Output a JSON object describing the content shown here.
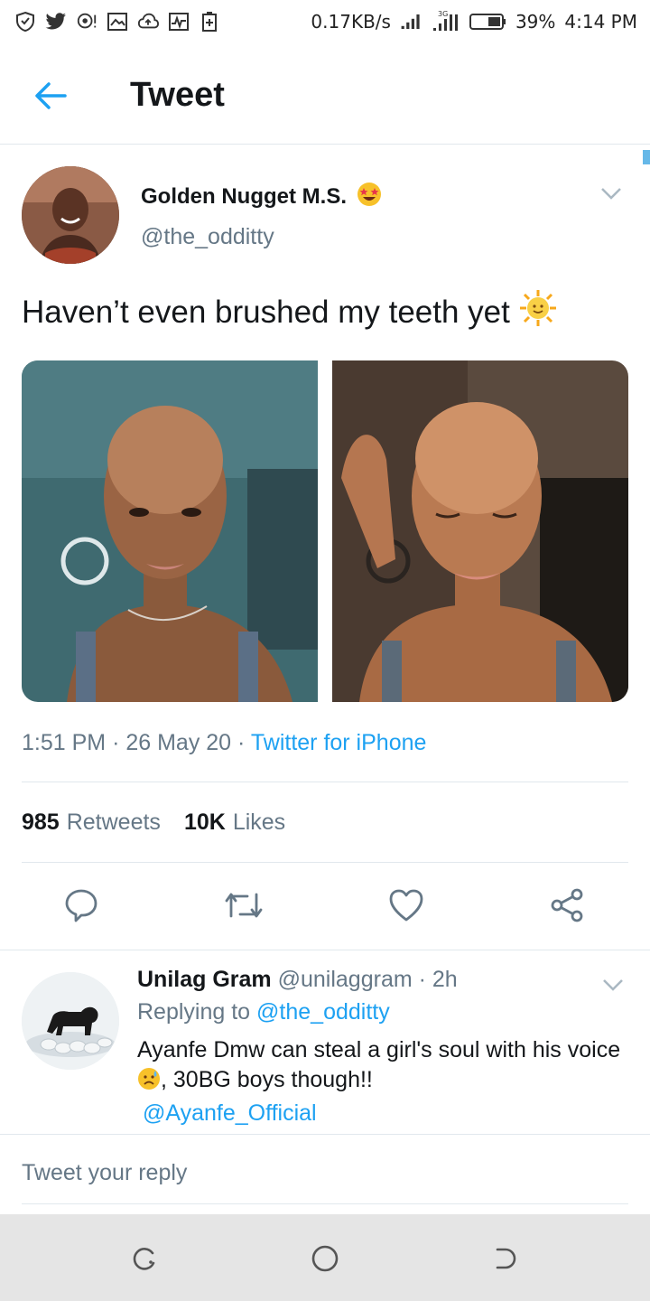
{
  "status_bar": {
    "speed": "0.17KB/s",
    "network": "3G",
    "battery": "39%",
    "time": "4:14 PM"
  },
  "header": {
    "title": "Tweet"
  },
  "tweet": {
    "author_name": "Golden Nugget M.S.",
    "author_emoji": "star-struck-emoji",
    "author_handle": "@the_odditty",
    "text": "Haven’t even brushed my teeth yet",
    "text_emoji": "sun-with-face-emoji",
    "time": "1:51 PM",
    "date": "26 May 20",
    "source": "Twitter for iPhone",
    "retweets_count": "985",
    "retweets_label": "Retweets",
    "likes_count": "10K",
    "likes_label": "Likes"
  },
  "reply": {
    "name": "Unilag Gram",
    "handle": "@unilaggram",
    "age": "2h",
    "replying_prefix": "Replying to",
    "replying_handle": "@the_odditty",
    "text_line1": "Ayanfe Dmw can steal a girl's soul with his voice",
    "text_line2": ", 30BG boys though!!",
    "mention": "@Ayanfe_Official"
  },
  "compose": {
    "placeholder": "Tweet your reply"
  },
  "colors": {
    "accent": "#1da1f2",
    "secondary_text": "#657786",
    "divider": "#e1e8ed",
    "nav_bg": "#e5e5e5"
  }
}
